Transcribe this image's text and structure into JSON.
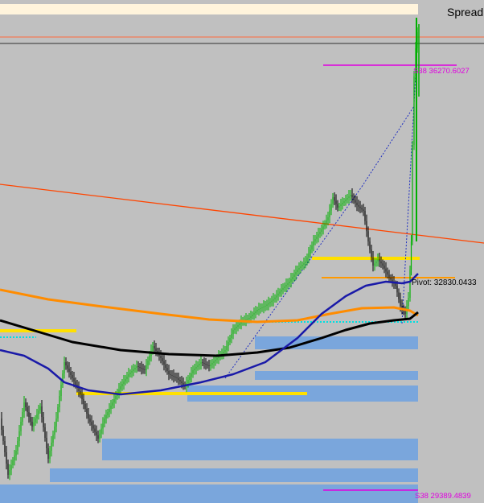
{
  "header": {
    "title_fragment": "Spread"
  },
  "chart_data": {
    "type": "candlestick",
    "instrument_note": "",
    "levels": {
      "upper_target": {
        "label": "S38 36270.6027",
        "value": 36270.6027,
        "color": "#e000e0"
      },
      "pivot": {
        "label": "Pivot: 32830.0433",
        "value": 32830.0433,
        "color": "#000000"
      },
      "lower_target": {
        "label": "S38 29389.4839",
        "value": 29389.4839,
        "color": "#e000e0"
      }
    },
    "colors": {
      "background": "#c0c0c0",
      "bull_candle": "#00b000",
      "bear_candle": "#000000",
      "ma_fast": "#1a1aa8",
      "ma_slow": "#000000",
      "ma_orange": "#ff8c00",
      "trendline": "#ff4500",
      "zone": "#7aa6dc",
      "yellow_level": "#ffe000",
      "orange_level": "#ff9900",
      "cyan_level": "#00e0e0"
    },
    "grid": false,
    "legend": "none"
  }
}
